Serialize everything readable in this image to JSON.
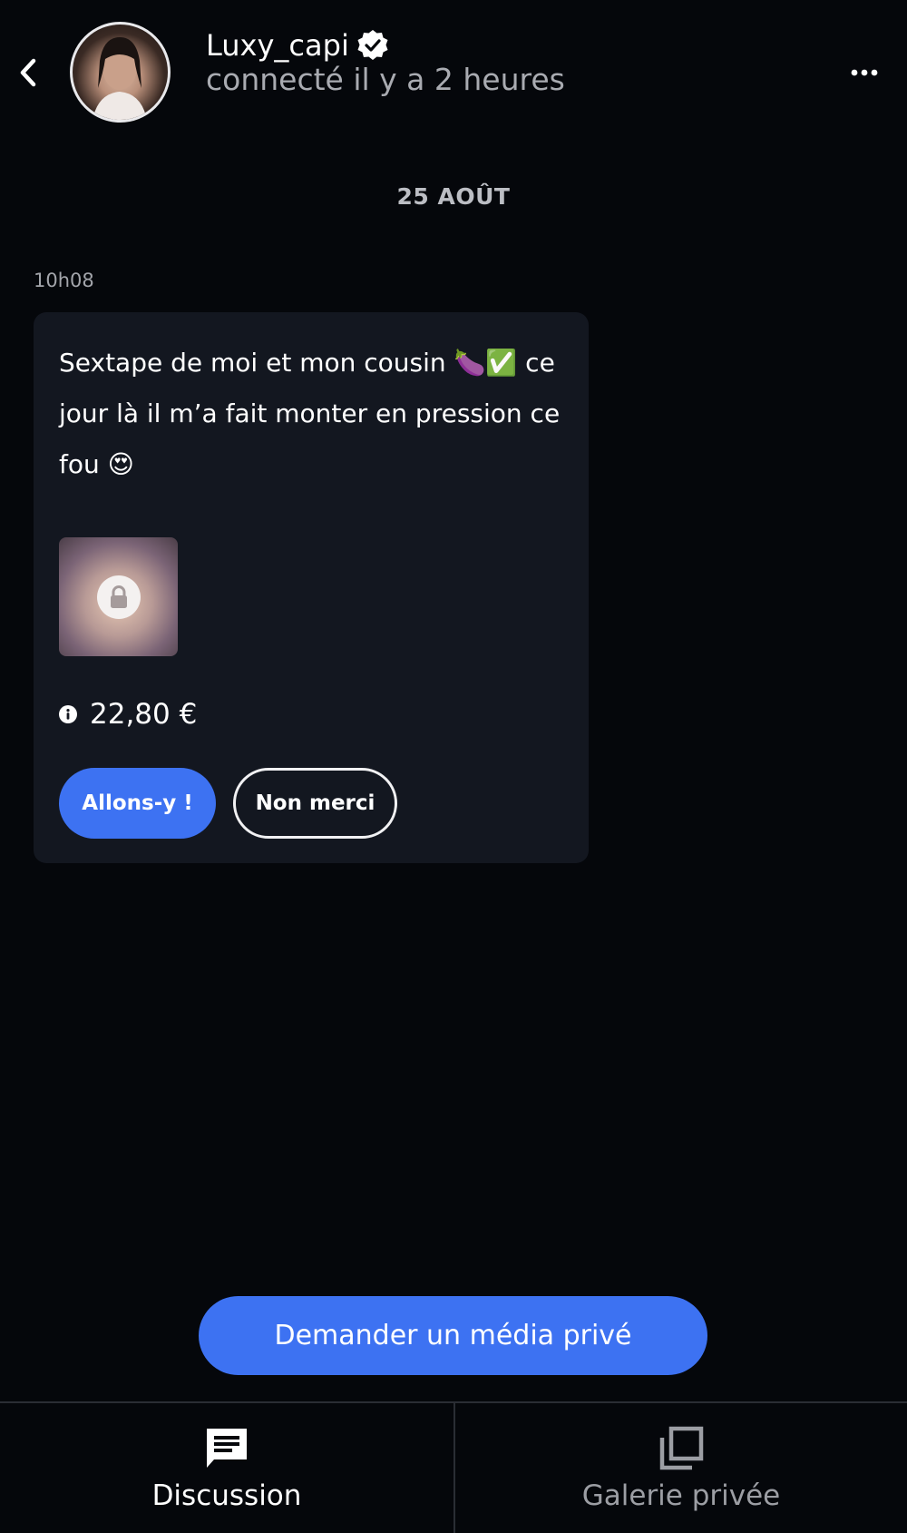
{
  "header": {
    "username": "Luxy_capi",
    "status": "connecté il y a 2 heures",
    "verified": true
  },
  "conversation": {
    "date_separator": "25 AOÛT",
    "message": {
      "time": "10h08",
      "text": "Sextape de moi et mon cousin 🍆✅ ce jour là il m’a fait monter en pression ce fou 😍",
      "media_locked": true,
      "price": "22,80 €",
      "accept_label": "Allons-y !",
      "decline_label": "Non merci"
    }
  },
  "cta": {
    "label": "Demander un média privé"
  },
  "tabs": [
    {
      "label": "Discussion",
      "icon": "chat-icon",
      "active": true
    },
    {
      "label": "Galerie privée",
      "icon": "gallery-icon",
      "active": false
    }
  ],
  "colors": {
    "background": "#05070b",
    "bubble": "#131720",
    "accent": "#3d72f2",
    "muted_text": "#a9abb1"
  }
}
